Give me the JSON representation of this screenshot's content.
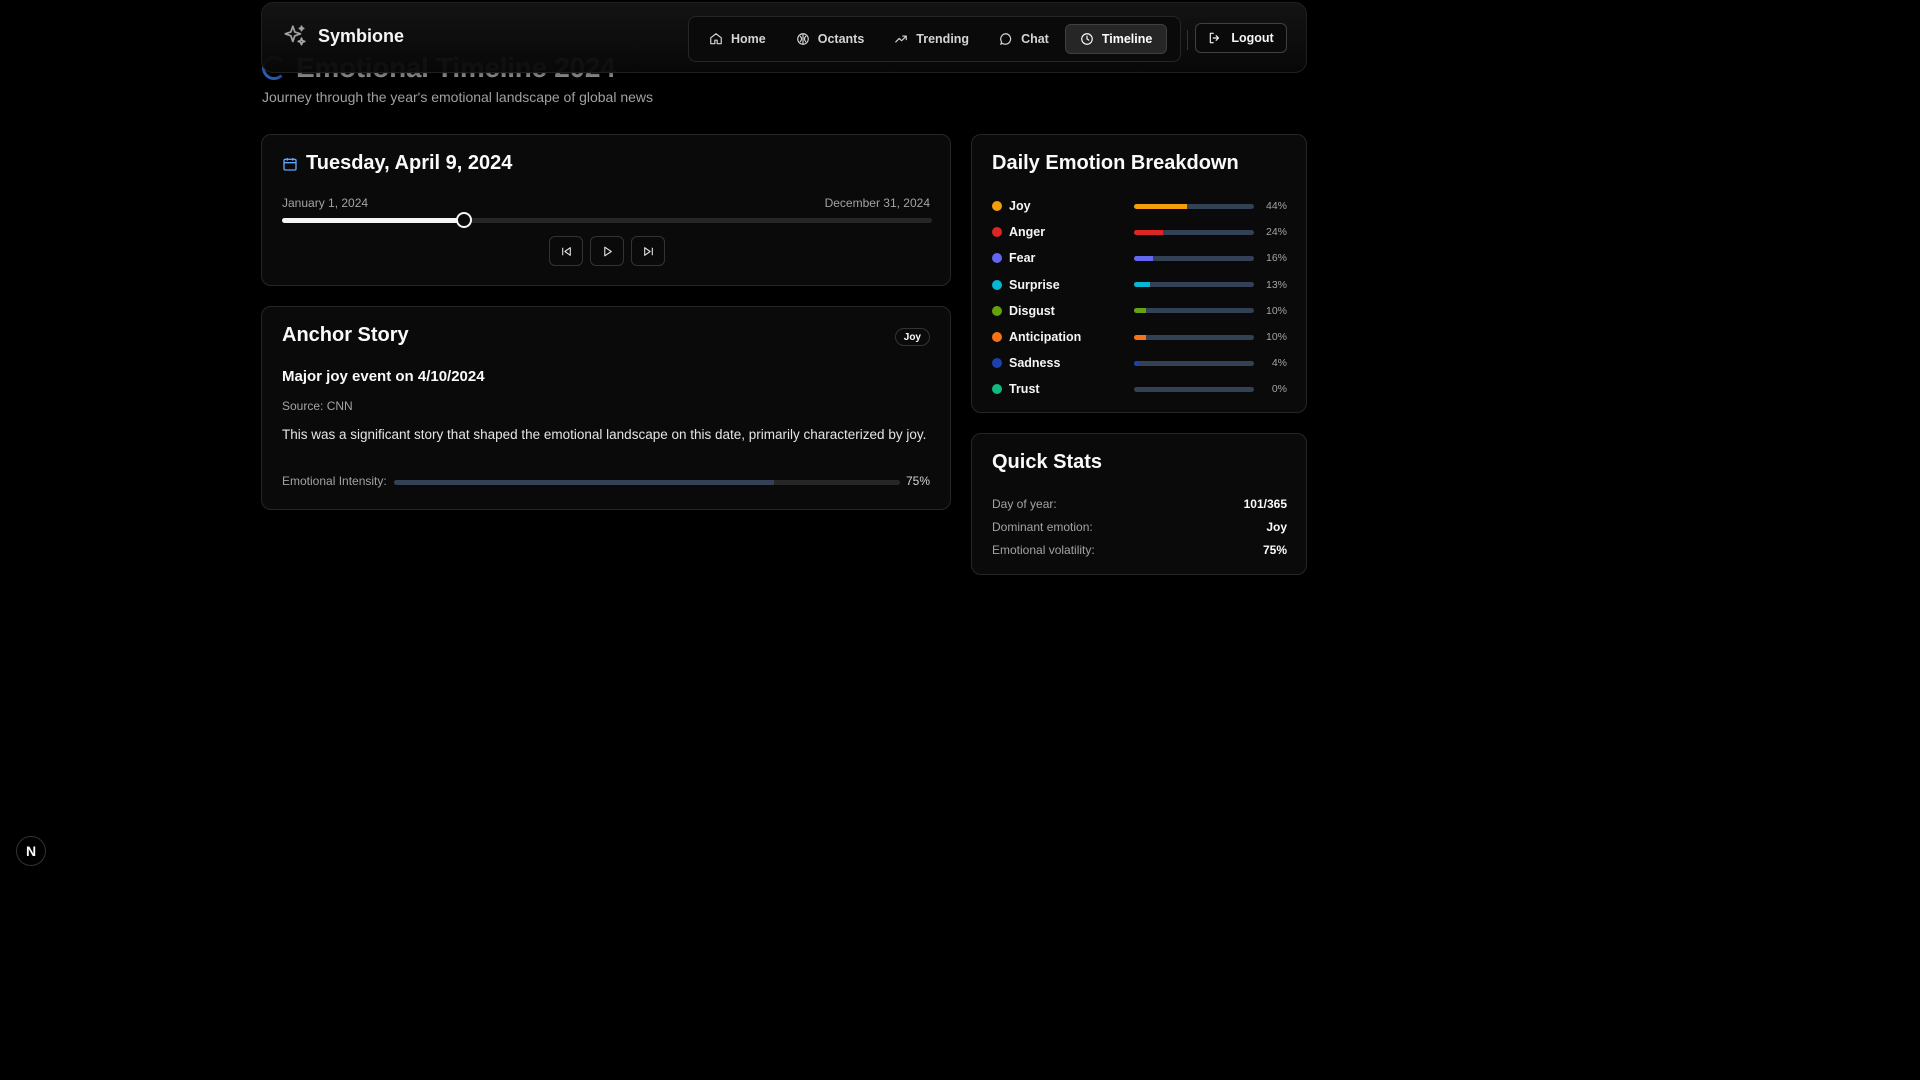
{
  "page": {
    "title": "Emotional Timeline 2024",
    "subtitle": "Journey through the year's emotional landscape of global news"
  },
  "nav": {
    "brand": "Symbione",
    "items": [
      {
        "label": "Home",
        "icon": "home-icon"
      },
      {
        "label": "Octants",
        "icon": "octants-icon"
      },
      {
        "label": "Trending",
        "icon": "trending-icon"
      },
      {
        "label": "Chat",
        "icon": "chat-icon"
      },
      {
        "label": "Timeline",
        "icon": "clock-icon",
        "active": true
      }
    ],
    "logout": "Logout"
  },
  "date_card": {
    "date": "Tuesday, April 9, 2024",
    "range_start": "January 1, 2024",
    "range_end": "December 31, 2024",
    "slider_progress": 0.28,
    "controls": [
      "skip-back-icon",
      "play-icon",
      "skip-forward-icon"
    ]
  },
  "anchor": {
    "title": "Anchor Story",
    "badge": "Joy",
    "headline": "Major joy event on 4/10/2024",
    "source": "Source: CNN",
    "body": "This was a significant story that shaped the emotional landscape on this date, primarily characterized by joy.",
    "intensity_label": "Emotional Intensity:",
    "intensity_value": "75%",
    "intensity": 0.75
  },
  "emotions": {
    "title": "Daily Emotion Breakdown",
    "items": [
      {
        "name": "Joy",
        "pct": "44%",
        "value": 44,
        "color": "#f59e0b"
      },
      {
        "name": "Anger",
        "pct": "24%",
        "value": 24,
        "color": "#dc2626"
      },
      {
        "name": "Fear",
        "pct": "16%",
        "value": 16,
        "color": "#6366f1"
      },
      {
        "name": "Surprise",
        "pct": "13%",
        "value": 13,
        "color": "#06b6d4"
      },
      {
        "name": "Disgust",
        "pct": "10%",
        "value": 10,
        "color": "#65a30d"
      },
      {
        "name": "Anticipation",
        "pct": "10%",
        "value": 10,
        "color": "#f97316"
      },
      {
        "name": "Sadness",
        "pct": "4%",
        "value": 4,
        "color": "#1e40af"
      },
      {
        "name": "Trust",
        "pct": "0%",
        "value": 0,
        "color": "#10b981"
      }
    ]
  },
  "stats": {
    "title": "Quick Stats",
    "rows": [
      {
        "label": "Day of year:",
        "value": "101/365"
      },
      {
        "label": "Dominant emotion:",
        "value": "Joy"
      },
      {
        "label": "Emotional volatility:",
        "value": "75%"
      }
    ]
  },
  "dev_badge": "N"
}
